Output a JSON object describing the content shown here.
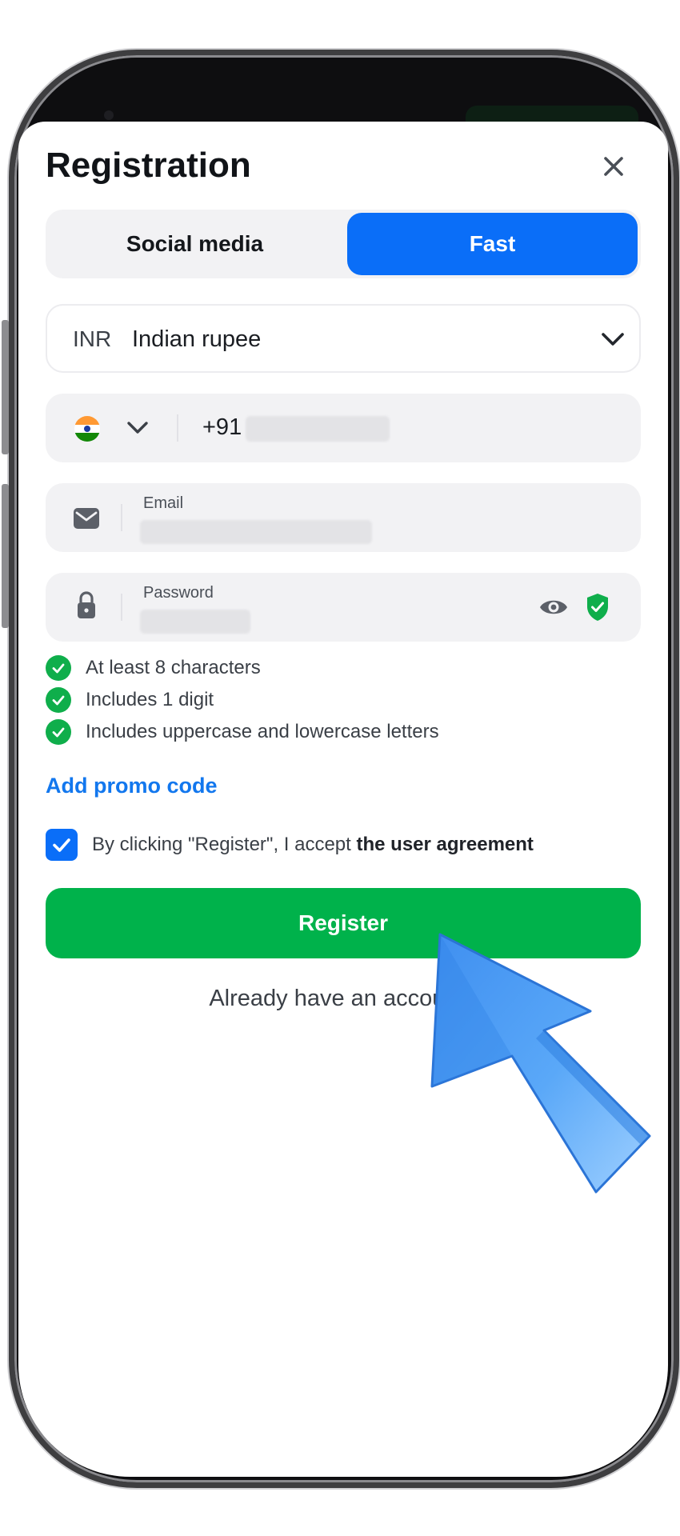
{
  "registration": {
    "title": "Registration",
    "close_icon": "close-icon"
  },
  "tabs": [
    {
      "label": "Social media",
      "active": false
    },
    {
      "label": "Fast",
      "active": true
    }
  ],
  "currency": {
    "code": "INR",
    "name": "Indian rupee",
    "dropdown_icon": "chevron-down-icon"
  },
  "phone": {
    "country_flag": "india-flag-icon",
    "prefix": "+91"
  },
  "email": {
    "label": "Email",
    "icon": "mail-icon"
  },
  "password": {
    "label": "Password",
    "icon": "lock-icon",
    "visibility_icon": "eye-icon",
    "strength_icon": "shield-check-icon"
  },
  "requirements": [
    "At least 8 characters",
    "Includes 1 digit",
    "Includes uppercase and lowercase letters"
  ],
  "promo_link": "Add promo code",
  "agreement": {
    "checked": true,
    "text": "By clicking \"Register\", I accept ",
    "link": "the user agreement"
  },
  "register_button": "Register",
  "login_prompt": "Already have an account",
  "login_prompt_suffix": "?",
  "colors": {
    "primary_blue": "#0a6ef8",
    "success_green": "#00b24b",
    "check_green": "#0fae4b",
    "link_blue": "#1277ee",
    "arrow_blue": "#4a9cf5"
  }
}
